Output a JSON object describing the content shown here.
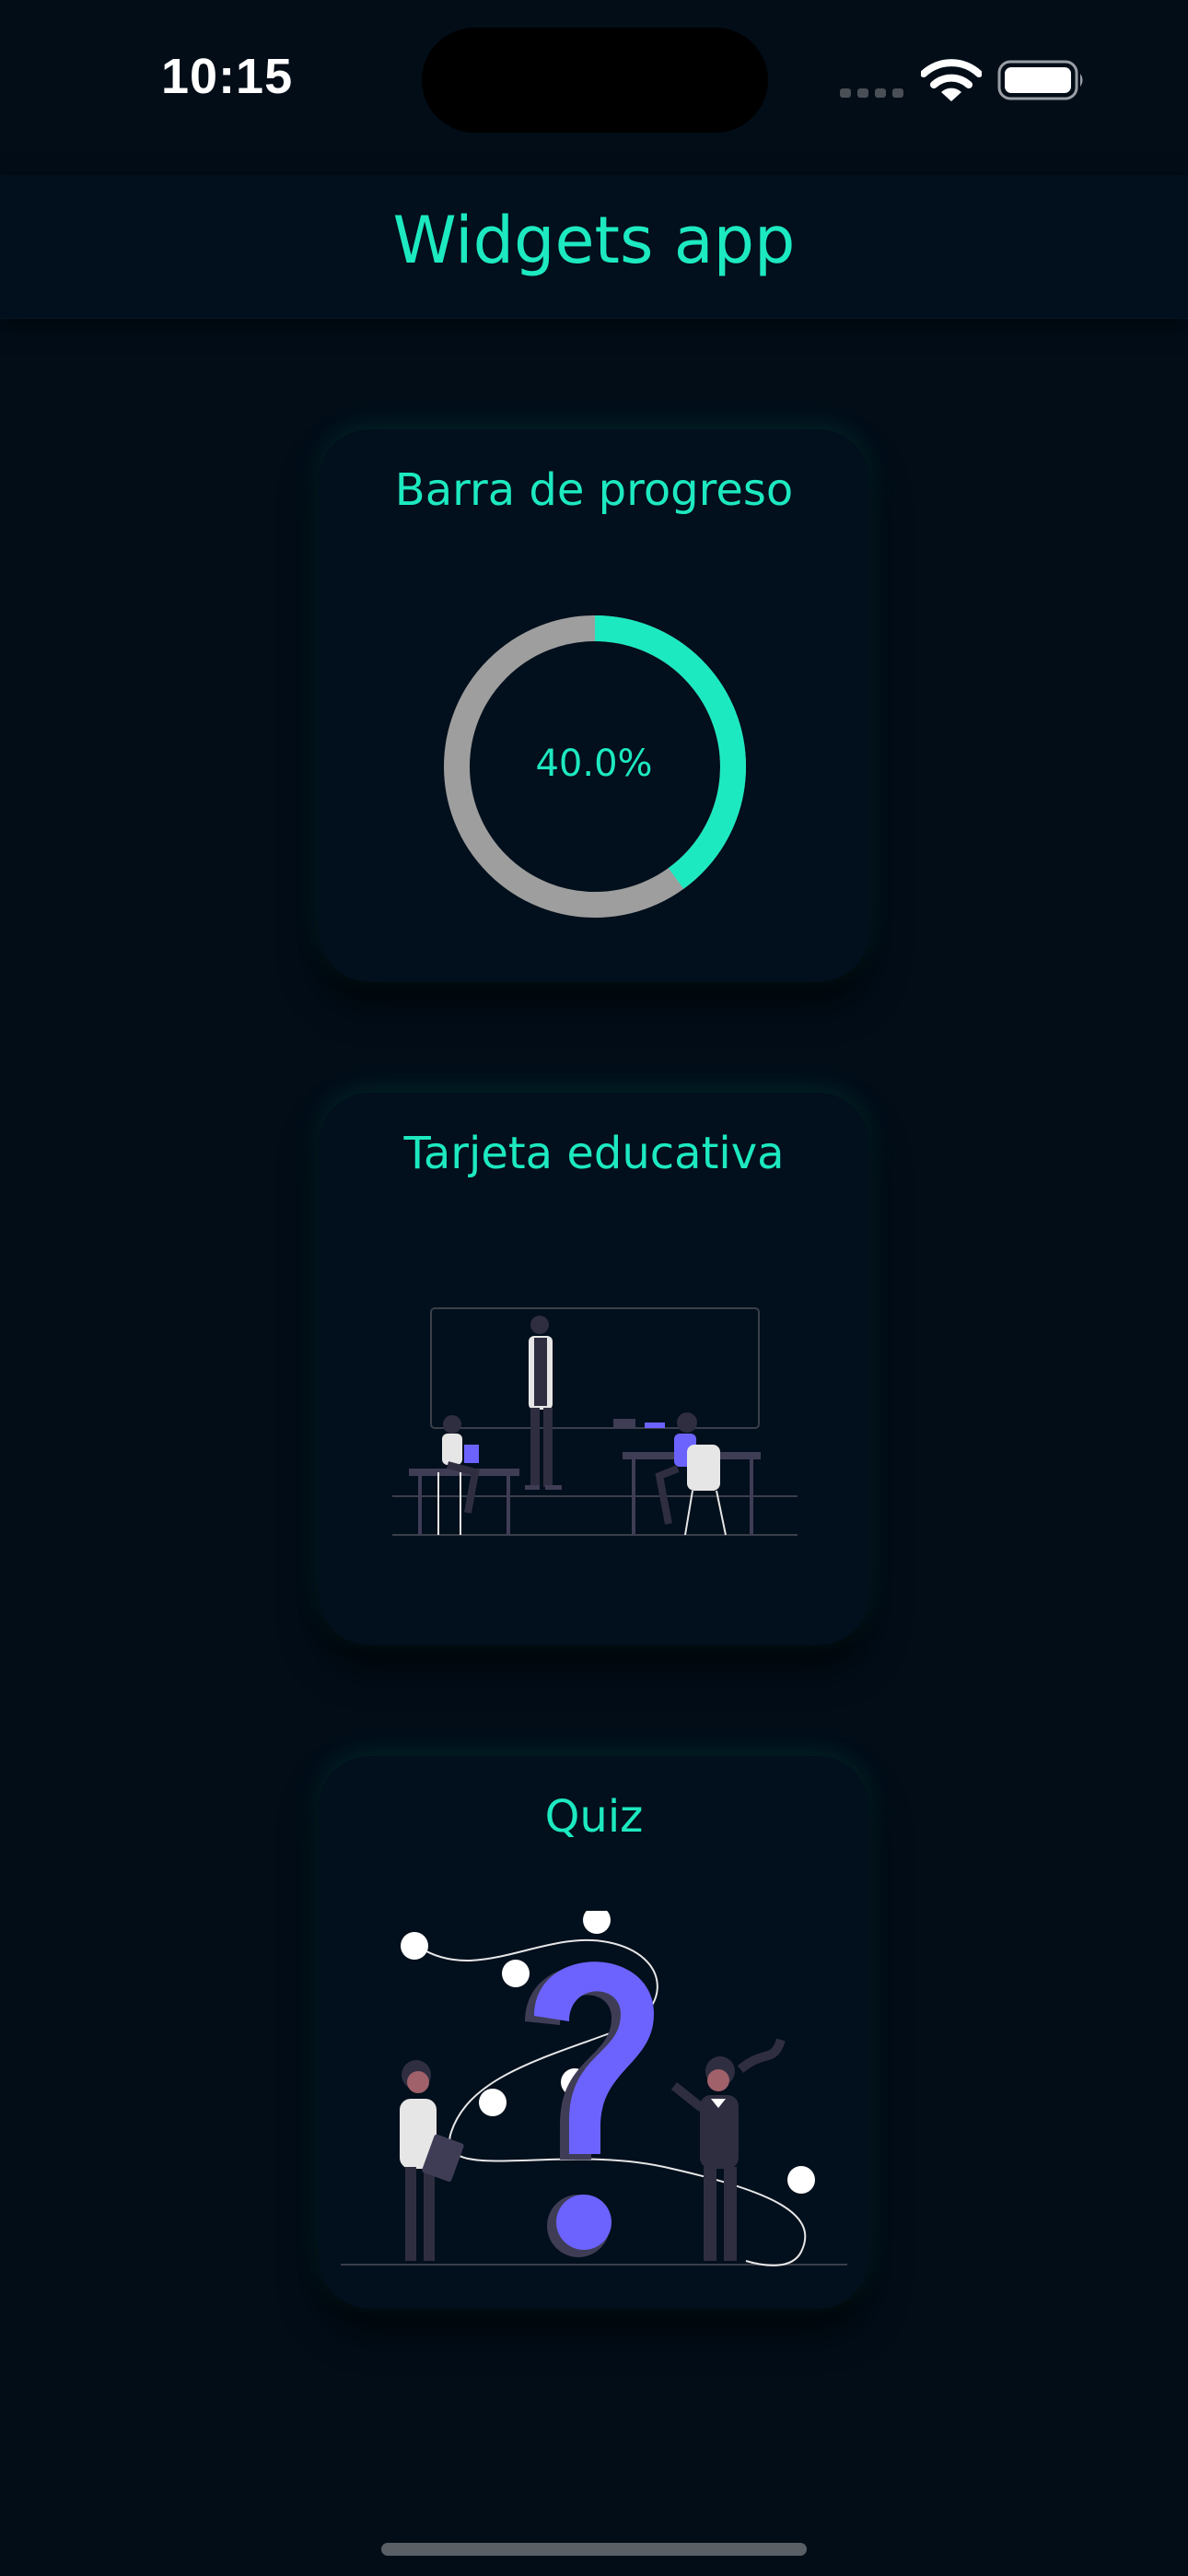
{
  "status_bar": {
    "time": "10:15",
    "icons": [
      "cellular-signal-icon",
      "wifi-icon",
      "battery-icon"
    ]
  },
  "app_bar": {
    "title": "Widgets app"
  },
  "cards": {
    "progress": {
      "title": "Barra de progreso",
      "value_text": "40.0%",
      "progress": 0.4
    },
    "educational": {
      "title": "Tarjeta educativa",
      "illustration": "classroom-illustration"
    },
    "quiz": {
      "title": "Quiz",
      "illustration": "question-mark-illustration"
    }
  },
  "colors": {
    "background": "#020d18",
    "accent": "#1de9c0",
    "track": "#9e9e9e",
    "purple": "#6c63ff"
  }
}
